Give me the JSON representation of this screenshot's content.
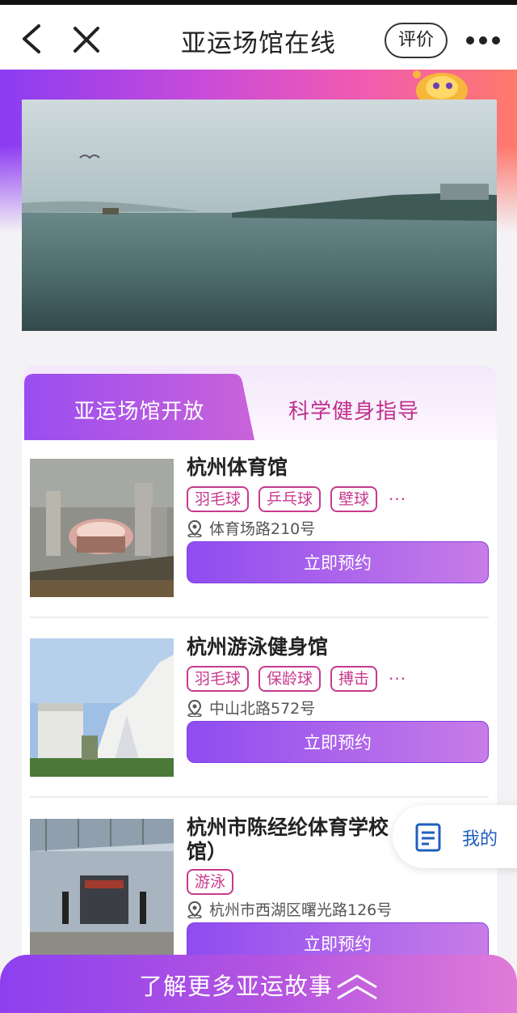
{
  "header": {
    "title": "亚运场馆在线",
    "review_label": "评价"
  },
  "tabs": [
    {
      "label": "亚运场馆开放",
      "active": true
    },
    {
      "label": "科学健身指导",
      "active": false
    }
  ],
  "venues": [
    {
      "name": "杭州体育馆",
      "tags": [
        "羽毛球",
        "乒乓球",
        "壁球"
      ],
      "more": "···",
      "address": "体育场路210号",
      "button": "立即预约"
    },
    {
      "name": "杭州游泳健身馆",
      "tags": [
        "羽毛球",
        "保龄球",
        "搏击"
      ],
      "more": "···",
      "address": "中山北路572号",
      "button": "立即预约"
    },
    {
      "name_line1": "杭州市陈经纶体育学校",
      "name_line2": "馆）",
      "tags": [
        "游泳"
      ],
      "address": "杭州市西湖区曙光路126号",
      "button": "立即预约"
    }
  ],
  "float_button": {
    "label": "我的"
  },
  "bottom": {
    "label": "了解更多亚运故事"
  },
  "colors": {
    "accent_purple": "#8f4cf0",
    "tag_magenta": "#c73a8e",
    "link_blue": "#1f5fbe"
  }
}
